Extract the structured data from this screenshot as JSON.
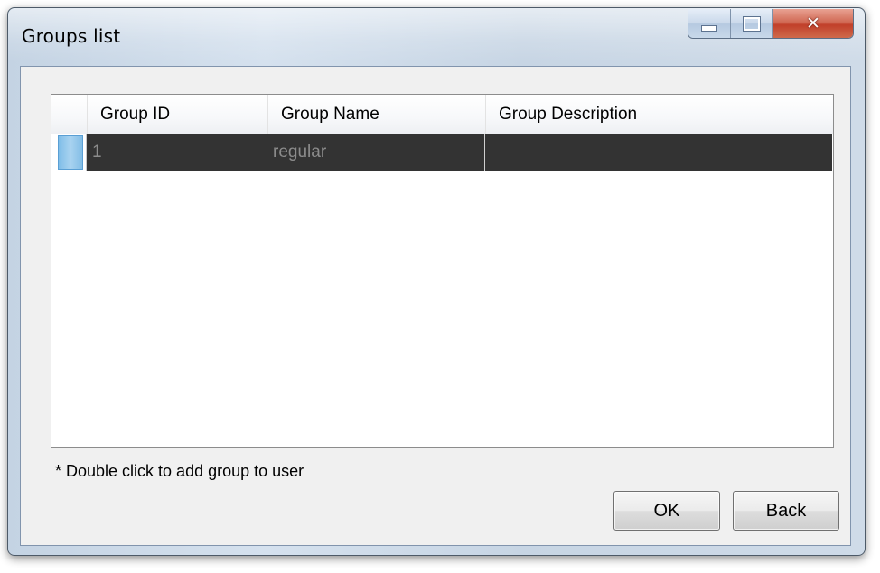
{
  "window": {
    "title": "Groups list",
    "close_glyph": "✕",
    "minimize_icon": "minimize-icon",
    "maximize_icon": "maximize-icon",
    "close_icon": "close-icon"
  },
  "grid": {
    "columns": [
      "Group ID",
      "Group Name",
      "Group Description"
    ],
    "rows": [
      {
        "group_id": "1",
        "group_name": "regular",
        "group_description": ""
      }
    ],
    "selected_row_color": "#333333",
    "selected_row_text_color": "#8c8c8c"
  },
  "note": "* Double click to add group to user",
  "buttons": {
    "ok_label": "OK",
    "back_label": "Back"
  }
}
